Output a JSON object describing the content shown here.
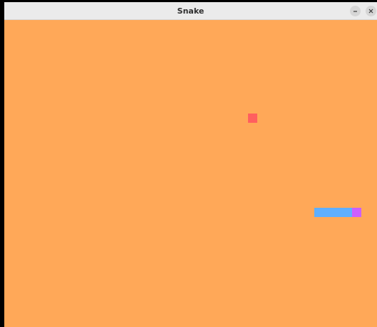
{
  "window": {
    "title": "Snake",
    "minimize_icon": "minimize-icon",
    "close_icon": "close-icon"
  },
  "game": {
    "background_color": "#ffa858",
    "food": {
      "color": "#ff5f5f"
    },
    "snake": {
      "direction": "right",
      "body_color": "#5fafff",
      "head_color": "#cc5fff"
    }
  }
}
